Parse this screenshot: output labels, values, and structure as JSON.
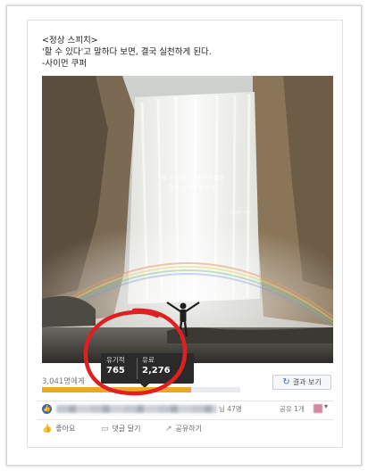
{
  "post": {
    "lines": [
      "<정상 스피치>",
      "'할 수 있다'고 말하다 보면, 결국 실천하게 된다.",
      "-사이먼 쿠퍼"
    ]
  },
  "image": {
    "quote_line1": "'할 수 있다'고 말하다 보면",
    "quote_line2": "결국 실천하게 된다",
    "signature": "- 사이먼 쿠퍼"
  },
  "stats": {
    "organic_label": "유기적",
    "organic_value": "765",
    "paid_label": "유료",
    "paid_value": "2,276"
  },
  "reach": {
    "text": "3,041명에게",
    "progress_fraction": 0.75
  },
  "results_button": "결과 보기",
  "likes": {
    "count_text": "님 47명",
    "share_text": "공유 1개"
  },
  "actions": {
    "like": "좋아요",
    "comment": "댓글 달기",
    "share": "공유하기"
  },
  "colors": {
    "progress": "#f0a52b",
    "facebook_blue": "#4267b2",
    "annotation_red": "#e02020"
  }
}
